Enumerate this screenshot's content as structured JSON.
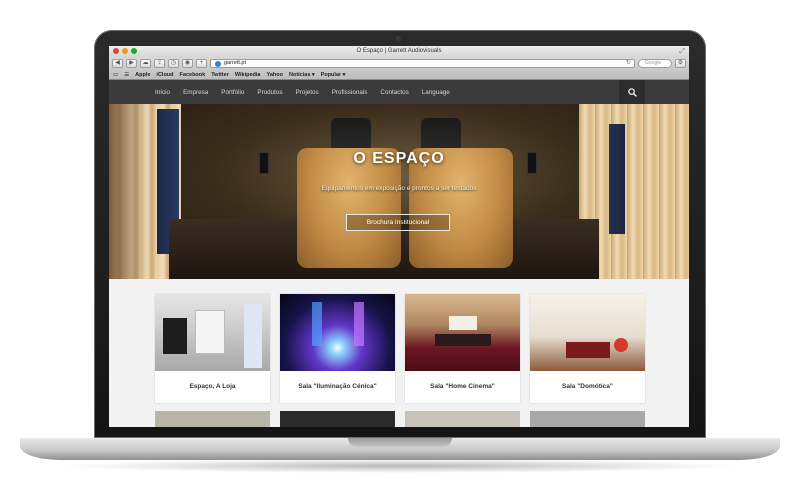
{
  "browser": {
    "window_title": "O Espaço | Garrett Audiovisuals",
    "url": "garrett.pt",
    "search_placeholder": "Google",
    "bookmarks": [
      "Apple",
      "iCloud",
      "Facebook",
      "Twitter",
      "Wikipedia",
      "Yahoo",
      "Notícias ▾",
      "Popular ▾"
    ]
  },
  "site": {
    "nav": [
      "Início",
      "Empresa",
      "Portfólio",
      "Produtos",
      "Projetos",
      "Profissionais",
      "Contactos",
      "Language"
    ],
    "hero": {
      "title": "O ESPAÇO",
      "subtitle": "Equipamentos em exposição e prontos a ser testados",
      "button": "Brochura Institucional"
    },
    "cards": [
      {
        "label": "Espaço, A Loja"
      },
      {
        "label": "Sala \"Iluminação Cénica\""
      },
      {
        "label": "Sala \"Home Cinema\""
      },
      {
        "label": "Sala \"Domótica\""
      }
    ]
  },
  "colors": {
    "nav_bg": "#3b3b3b",
    "page_bg": "#f2f2f2",
    "card_bg": "#ffffff"
  },
  "icons": [
    "back-icon",
    "forward-icon",
    "cloud-icon",
    "share-icon",
    "history-icon",
    "reader-icon",
    "add-tab-icon",
    "globe-icon",
    "reload-icon",
    "settings-icon",
    "search-icon"
  ]
}
